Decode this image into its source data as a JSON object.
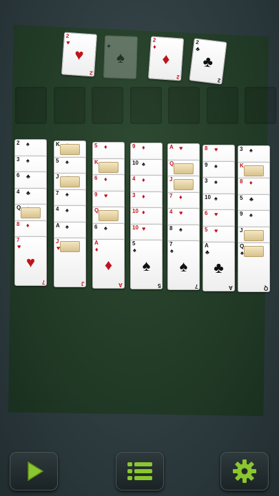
{
  "colors": {
    "table": "#213a26",
    "background": "#2c3a3e",
    "card": "#ffffff",
    "red": "#c0121b",
    "black": "#111111",
    "accent": "#8ac72e"
  },
  "foundations": [
    {
      "rank": "2",
      "suit": "♥",
      "ghost": false
    },
    {
      "rank": "",
      "suit": "♠",
      "ghost": true
    },
    {
      "rank": "2",
      "suit": "♦",
      "ghost": false
    },
    {
      "rank": "2",
      "suit": "♣",
      "ghost": false
    }
  ],
  "free_cells": 7,
  "tableau": [
    [
      {
        "r": "2",
        "s": "♠"
      },
      {
        "r": "3",
        "s": "♠"
      },
      {
        "r": "6",
        "s": "♣"
      },
      {
        "r": "4",
        "s": "♣"
      },
      {
        "r": "Q",
        "s": "♣"
      },
      {
        "r": "8",
        "s": "♦"
      },
      {
        "r": "7",
        "s": "♥"
      }
    ],
    [
      {
        "r": "K",
        "s": "♣"
      },
      {
        "r": "5",
        "s": "♠"
      },
      {
        "r": "J",
        "s": "♣"
      },
      {
        "r": "7",
        "s": "♠"
      },
      {
        "r": "4",
        "s": "♠"
      },
      {
        "r": "A",
        "s": "♠"
      },
      {
        "r": "J",
        "s": "♥"
      }
    ],
    [
      {
        "r": "5",
        "s": "♦"
      },
      {
        "r": "K",
        "s": "♦"
      },
      {
        "r": "6",
        "s": "♦"
      },
      {
        "r": "9",
        "s": "♥"
      },
      {
        "r": "Q",
        "s": "♦"
      },
      {
        "r": "6",
        "s": "♠"
      },
      {
        "r": "A",
        "s": "♦"
      }
    ],
    [
      {
        "r": "9",
        "s": "♦"
      },
      {
        "r": "10",
        "s": "♠"
      },
      {
        "r": "4",
        "s": "♦"
      },
      {
        "r": "3",
        "s": "♦"
      },
      {
        "r": "10",
        "s": "♦"
      },
      {
        "r": "10",
        "s": "♥"
      },
      {
        "r": "5",
        "s": "♠"
      }
    ],
    [
      {
        "r": "A",
        "s": "♥"
      },
      {
        "r": "Q",
        "s": "♥"
      },
      {
        "r": "J",
        "s": "♦"
      },
      {
        "r": "7",
        "s": "♦"
      },
      {
        "r": "4",
        "s": "♥"
      },
      {
        "r": "8",
        "s": "♠"
      },
      {
        "r": "7",
        "s": "♠"
      }
    ],
    [
      {
        "r": "8",
        "s": "♥"
      },
      {
        "r": "9",
        "s": "♠"
      },
      {
        "r": "3",
        "s": "♠"
      },
      {
        "r": "10",
        "s": "♠"
      },
      {
        "r": "6",
        "s": "♥"
      },
      {
        "r": "5",
        "s": "♥"
      },
      {
        "r": "A",
        "s": "♣"
      }
    ],
    [
      {
        "r": "3",
        "s": "♠"
      },
      {
        "r": "K",
        "s": "♥"
      },
      {
        "r": "8",
        "s": "♦"
      },
      {
        "r": "5",
        "s": "♣"
      },
      {
        "r": "9",
        "s": "♠"
      },
      {
        "r": "J",
        "s": "♠"
      },
      {
        "r": "Q",
        "s": "♠"
      }
    ]
  ],
  "buttons": {
    "play": "play-icon",
    "menu": "menu-icon",
    "settings": "gear-icon"
  }
}
